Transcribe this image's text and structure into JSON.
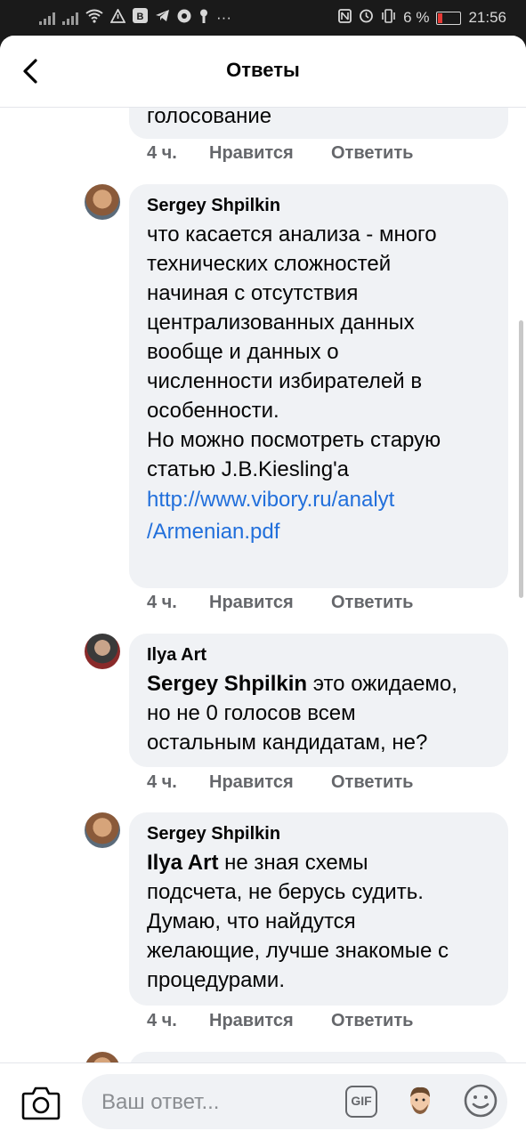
{
  "status_bar": {
    "time": "21:56",
    "battery": "6 %",
    "icons": [
      "signal-icon",
      "signal-icon",
      "wifi-icon",
      "warning-icon",
      "vk-icon",
      "telegram-icon",
      "chrome-icon",
      "key-icon",
      "more-icon",
      "nfc-icon",
      "alarm-icon",
      "vibrate-icon",
      "battery-icon"
    ]
  },
  "header": {
    "title": "Ответы",
    "back_icon": "back-arrow-icon"
  },
  "comments": [
    {
      "partial_text": "голосование",
      "time": "4 ч.",
      "like": "Нравится",
      "reply": "Ответить"
    },
    {
      "author": "Sergey Shpilkin",
      "text": "что касается анализа - много\nтехнических сложностей\nначиная с отсутствия\nцентрализованных данных\nвообще и данных о\nчисленности избирателей в\nособенности.\nНо можно посмотреть старую\nстатью J.B.Kiesling'a",
      "link_line1": "http://www.vibory.ru/analyt",
      "link_line2": "/Armenian.pdf",
      "time": "4 ч.",
      "like": "Нравится",
      "reply": "Ответить"
    },
    {
      "author": "Ilya Art",
      "mention": "Sergey Shpilkin",
      "text": " это ожидаемо,\nно не 0 голосов всем\nостальным кандидатам, не?",
      "time": "4 ч.",
      "like": "Нравится",
      "reply": "Ответить"
    },
    {
      "author": "Sergey Shpilkin",
      "mention": "Ilya Art",
      "text": " не зная схемы\nподсчета, не берусь судить.\nДумаю, что найдутся\nжелающие, лучше знакомые с\nпроцедурами.",
      "time": "4 ч.",
      "like": "Нравится",
      "reply": "Ответить"
    }
  ],
  "composer": {
    "placeholder": "Ваш ответ...",
    "gif_label": "GIF",
    "camera_icon": "camera-icon",
    "sticker_icon": "sticker-icon",
    "emoji_icon": "emoji-icon"
  },
  "colors": {
    "bubble": "#f0f2f5",
    "link": "#216fdb",
    "meta": "#65676b",
    "status_bar": "#1a1a1a"
  }
}
